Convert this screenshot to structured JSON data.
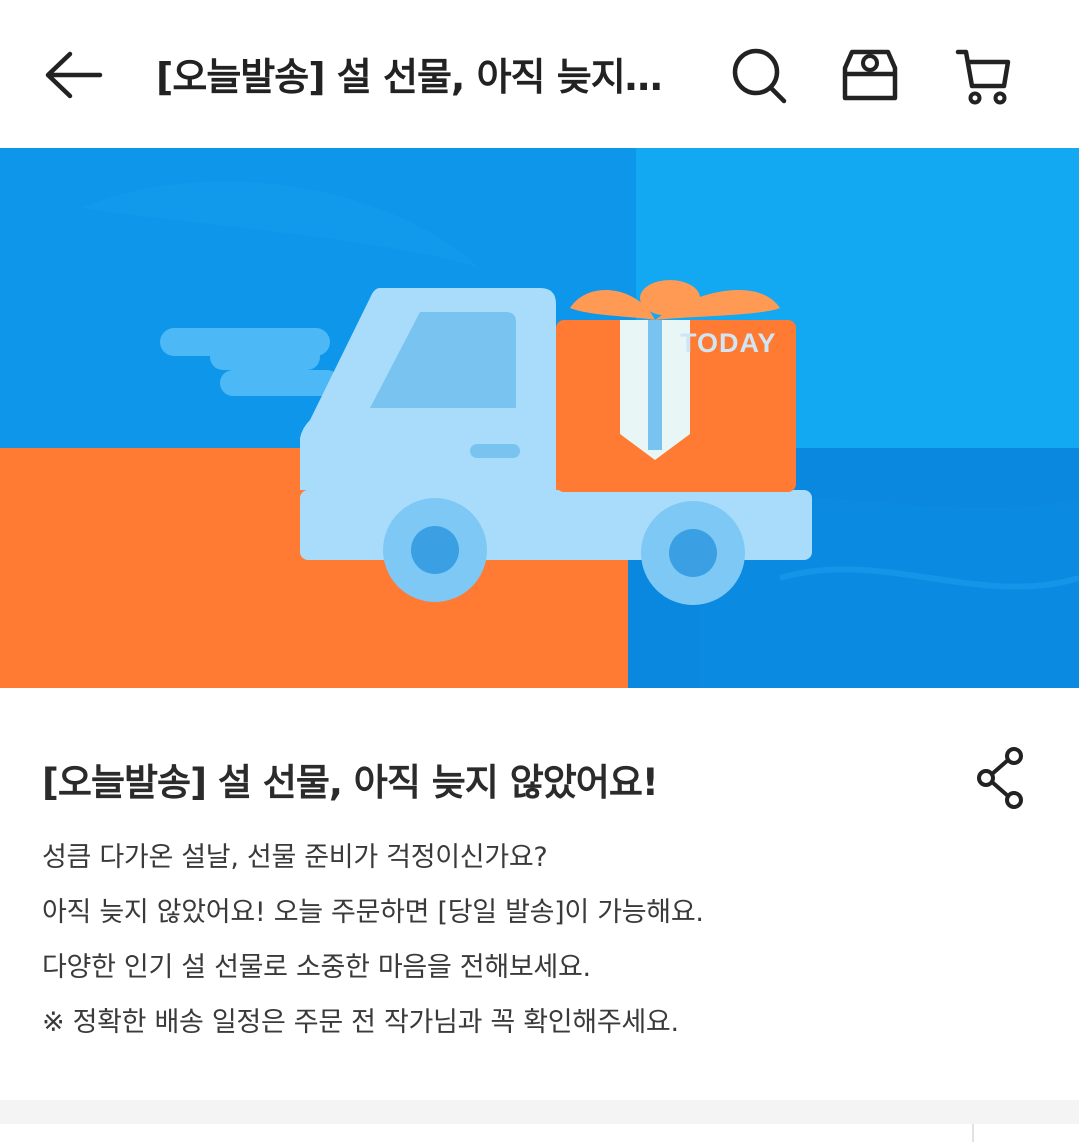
{
  "header": {
    "title": "[오늘발송] 설 선물, 아직 늦지 않았어요!",
    "icons": [
      "back-arrow-icon",
      "search-icon",
      "store-icon",
      "cart-icon"
    ]
  },
  "banner": {
    "badge": "TODAY",
    "colors": {
      "blue": "#0d96ea",
      "light_blue": "#12a8f2",
      "orange": "#ff7a33",
      "truck": "#a9dcfb"
    }
  },
  "post": {
    "title": "[오늘발송] 설 선물, 아직 늦지 않았어요!",
    "description": [
      "성큼 다가온 설날, 선물 준비가 걱정이신가요?",
      "아직 늦지 않았어요! 오늘 주문하면 [당일 발송]이 가능해요.",
      "다양한 인기 설 선물로 소중한 마음을 전해보세요.",
      "※ 정확한 배송 일정은 주문 전 작가님과 꼭 확인해주세요."
    ]
  }
}
